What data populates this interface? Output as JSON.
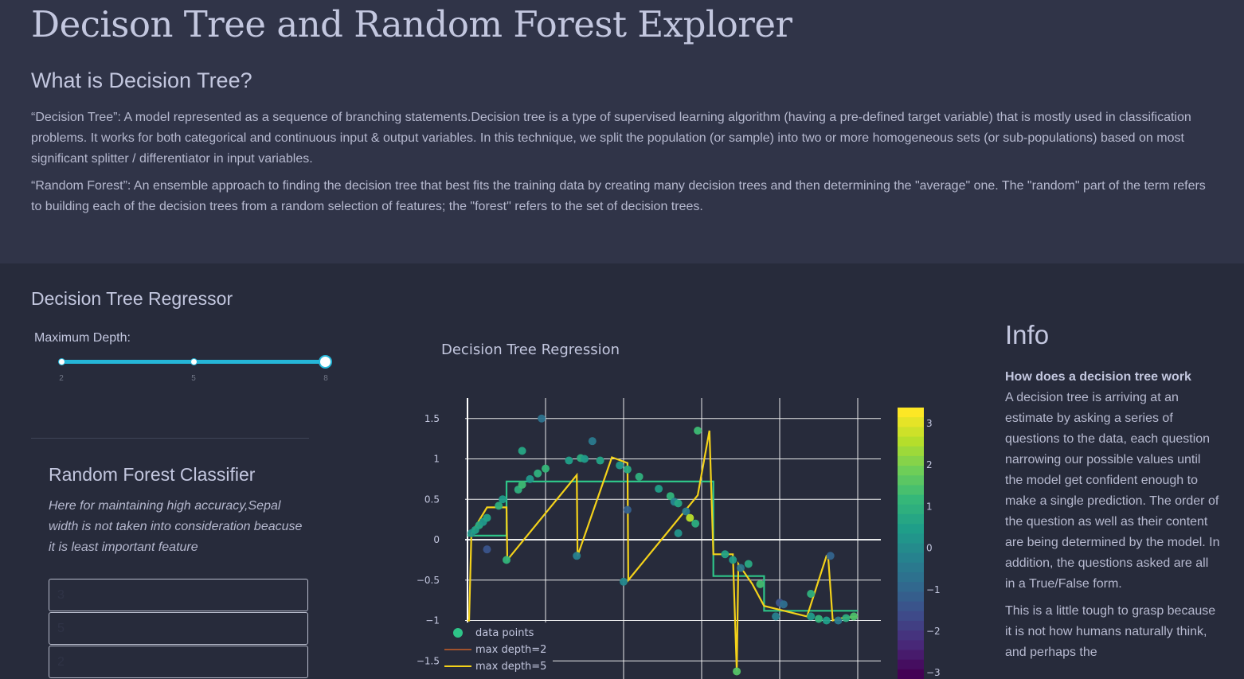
{
  "page": {
    "title": "Decison Tree and Random Forest Explorer",
    "subtitle": "What is Decision Tree?",
    "paragraph_1": "“Decision Tree”: A model represented as a sequence of branching statements.Decision tree is a type of supervised learning algorithm (having a pre-defined target variable) that is mostly used in classification problems. It works for both categorical and continuous input & output variables. In this technique, we split the population (or sample) into two or more homogeneous sets (or sub-populations) based on most significant splitter / differentiator in input variables.",
    "paragraph_2": "“Random Forest”: An ensemble approach to finding the decision tree that best fits the training data by creating many decision trees and then determining the \"average\" one. The \"random\" part of the term refers to building each of the decision trees from a random selection of features; the \"forest\" refers to the set of decision trees."
  },
  "regressor": {
    "title": "Decision Tree Regressor",
    "slider_label": "Maximum Depth:",
    "slider_min": "2",
    "slider_mid": "5",
    "slider_max": "8",
    "slider_value": 8
  },
  "random_forest": {
    "title": "Random Forest Classifier",
    "note": "Here for maintaining high accuracy,Sepal width is not taken into consideration beacuse it is least important feature",
    "inputs": [
      {
        "placeholder": "3"
      },
      {
        "placeholder": "5"
      },
      {
        "placeholder": "2"
      }
    ]
  },
  "info": {
    "title": "Info",
    "heading": "How does a decision tree work",
    "body_1": "A decision tree is arriving at an estimate by asking a series of questions to the data, each question narrowing our possible values until the model get confident enough to make a single prediction. The order of the question as well as their content are being determined by the model. In addition, the questions asked are all in a True/False form.",
    "body_2": "This is a little tough to grasp because it is not how humans naturally think, and perhaps the"
  },
  "colors": {
    "hero_bg": "#303448",
    "page_bg": "#272b3b",
    "accent": "#25b6d8",
    "depth2": "#a0522d",
    "depth5": "#f4d21a",
    "depth8": "#2ec488"
  },
  "chart_data": {
    "type": "scatter",
    "title": "Decision Tree Regression",
    "xlim": [
      -0.05,
      5.05
    ],
    "ylim": [
      -1.7,
      1.7
    ],
    "yticks": [
      -1.5,
      -1,
      -0.5,
      0,
      0.5,
      1,
      1.5
    ],
    "ytick_labels": [
      "−1.5",
      "−1",
      "−0.5",
      "0",
      "0.5",
      "1",
      "1.5"
    ],
    "grid": true,
    "legend_position": "bottom-left",
    "legend": [
      "data points",
      "max depth=2",
      "max depth=5"
    ],
    "colorscale": "viridis",
    "colorbar_ticks": [
      "3",
      "2",
      "1",
      "0",
      "−1",
      "−2",
      "−3"
    ],
    "points": [
      {
        "x": 0.05,
        "y": 0.08,
        "c": 0.1
      },
      {
        "x": 0.1,
        "y": 0.12,
        "c": 0.4
      },
      {
        "x": 0.15,
        "y": 0.18,
        "c": 0.6
      },
      {
        "x": 0.2,
        "y": 0.22,
        "c": 0.2
      },
      {
        "x": 0.25,
        "y": 0.27,
        "c": 0.5
      },
      {
        "x": 0.25,
        "y": -0.12,
        "c": -1.6
      },
      {
        "x": 0.4,
        "y": 0.42,
        "c": 0.8
      },
      {
        "x": 0.45,
        "y": 0.5,
        "c": 0.3
      },
      {
        "x": 0.5,
        "y": -0.25,
        "c": 1.0
      },
      {
        "x": 0.65,
        "y": 0.62,
        "c": 0.9
      },
      {
        "x": 0.7,
        "y": 0.68,
        "c": 1.2
      },
      {
        "x": 0.7,
        "y": 1.1,
        "c": 0.6
      },
      {
        "x": 0.8,
        "y": 0.75,
        "c": 0.2
      },
      {
        "x": 0.9,
        "y": 0.82,
        "c": 0.9
      },
      {
        "x": 0.95,
        "y": 1.5,
        "c": -0.8
      },
      {
        "x": 1.0,
        "y": 0.88,
        "c": 1.1
      },
      {
        "x": 1.3,
        "y": 0.98,
        "c": 0.4
      },
      {
        "x": 1.4,
        "y": -0.2,
        "c": -0.4
      },
      {
        "x": 1.45,
        "y": 1.01,
        "c": 0.8
      },
      {
        "x": 1.5,
        "y": 1.0,
        "c": 0.3
      },
      {
        "x": 1.6,
        "y": 1.22,
        "c": -0.6
      },
      {
        "x": 1.7,
        "y": 0.98,
        "c": 0.5
      },
      {
        "x": 1.95,
        "y": 0.92,
        "c": 0.2
      },
      {
        "x": 2.05,
        "y": 0.87,
        "c": 0.7
      },
      {
        "x": 2.05,
        "y": 0.37,
        "c": -1.3
      },
      {
        "x": 2.0,
        "y": -0.52,
        "c": -0.2
      },
      {
        "x": 2.2,
        "y": 0.78,
        "c": 0.9
      },
      {
        "x": 2.45,
        "y": 0.63,
        "c": 0.4
      },
      {
        "x": 2.6,
        "y": 0.54,
        "c": 1.0
      },
      {
        "x": 2.65,
        "y": 0.47,
        "c": -0.3
      },
      {
        "x": 2.7,
        "y": 0.45,
        "c": 0.6
      },
      {
        "x": 2.7,
        "y": 0.08,
        "c": 0.1
      },
      {
        "x": 2.8,
        "y": 0.35,
        "c": -0.5
      },
      {
        "x": 2.85,
        "y": 0.27,
        "c": 2.6
      },
      {
        "x": 2.92,
        "y": 0.2,
        "c": 0.8
      },
      {
        "x": 2.95,
        "y": 1.35,
        "c": 1.2
      },
      {
        "x": 3.3,
        "y": -0.18,
        "c": 0.5
      },
      {
        "x": 3.4,
        "y": -0.25,
        "c": 0.3
      },
      {
        "x": 3.45,
        "y": -1.63,
        "c": 1.5
      },
      {
        "x": 3.5,
        "y": -0.35,
        "c": -0.7
      },
      {
        "x": 3.6,
        "y": -0.3,
        "c": 0.7
      },
      {
        "x": 3.75,
        "y": -0.55,
        "c": 1.3
      },
      {
        "x": 3.95,
        "y": -0.95,
        "c": -0.4
      },
      {
        "x": 4.0,
        "y": -0.78,
        "c": -1.6
      },
      {
        "x": 4.05,
        "y": -0.8,
        "c": -0.9
      },
      {
        "x": 4.4,
        "y": -0.67,
        "c": 0.9
      },
      {
        "x": 4.4,
        "y": -0.95,
        "c": 0.3
      },
      {
        "x": 4.5,
        "y": -0.98,
        "c": 1.0
      },
      {
        "x": 4.6,
        "y": -1.0,
        "c": 0.4
      },
      {
        "x": 4.65,
        "y": -0.2,
        "c": -1.2
      },
      {
        "x": 4.75,
        "y": -1.0,
        "c": -0.6
      },
      {
        "x": 4.85,
        "y": -0.97,
        "c": 0.8
      },
      {
        "x": 4.95,
        "y": -0.95,
        "c": 1.4
      }
    ],
    "series": [
      {
        "name": "max depth=2",
        "x": [
          0.0,
          0.5,
          0.5,
          3.15,
          3.15,
          3.8,
          3.8,
          5.0
        ],
        "y": [
          0.05,
          0.05,
          0.72,
          0.72,
          -0.45,
          -0.45,
          -0.88,
          -0.88
        ],
        "color": "#2ec488"
      },
      {
        "name": "max depth=5",
        "x": [
          0.0,
          0.02,
          0.02,
          0.05,
          0.05,
          0.25,
          0.25,
          0.5,
          0.5,
          0.51,
          0.51,
          1.4,
          1.4,
          1.41,
          1.41,
          1.85,
          1.85,
          2.05,
          2.05,
          2.06,
          2.06,
          2.95,
          2.95,
          3.1,
          3.1,
          3.15,
          3.15,
          3.4,
          3.4,
          3.45,
          3.45,
          3.47,
          3.47,
          3.65,
          3.65,
          3.8,
          3.8,
          4.35,
          4.35,
          4.6,
          4.6,
          4.62,
          4.62,
          4.68,
          4.68,
          4.8,
          4.8,
          5.0
        ],
        "y": [
          -1.0,
          -1.0,
          -1.0,
          0.08,
          0.08,
          0.4,
          0.4,
          0.4,
          0.4,
          -0.25,
          -0.25,
          0.8,
          0.8,
          -0.2,
          -0.2,
          1.02,
          1.02,
          0.95,
          0.95,
          -0.5,
          -0.5,
          0.55,
          0.55,
          1.35,
          1.35,
          -0.18,
          -0.18,
          -0.18,
          -0.18,
          -1.63,
          -1.63,
          -0.3,
          -0.3,
          -0.55,
          -0.55,
          -0.82,
          -0.82,
          -0.95,
          -0.95,
          -0.2,
          -0.2,
          -0.2,
          -0.2,
          -1.0,
          -1.0,
          -0.97,
          -0.97,
          -0.95
        ],
        "color": "#f4d21a"
      }
    ]
  }
}
